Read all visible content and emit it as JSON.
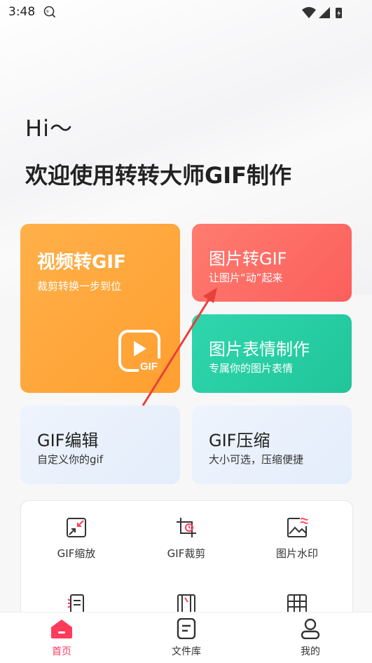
{
  "status_bar": {
    "time": "3:48"
  },
  "header": {
    "greeting": "Hi～",
    "welcome": "欢迎使用转转大师GIF制作"
  },
  "cards": {
    "video_to_gif": {
      "title": "视频转GIF",
      "subtitle": "裁剪转换一步到位",
      "badge": "GIF"
    },
    "image_to_gif": {
      "title": "图片转GIF",
      "subtitle": "让图片“动”起来"
    },
    "emoji_maker": {
      "title": "图片表情制作",
      "subtitle": "专属你的图片表情"
    },
    "gif_edit": {
      "title": "GIF编辑",
      "subtitle": "自定义你的gif"
    },
    "gif_compress": {
      "title": "GIF压缩",
      "subtitle": "大小可选，压缩便捷"
    }
  },
  "tools": [
    {
      "label": "GIF缩放",
      "icon": "resize-icon"
    },
    {
      "label": "GIF裁剪",
      "icon": "crop-icon"
    },
    {
      "label": "图片水印",
      "icon": "watermark-icon"
    }
  ],
  "tabbar": {
    "home": "首页",
    "files": "文件库",
    "mine": "我的"
  },
  "colors": {
    "accent": "#ff3b5c",
    "orange_card": "#ffa43a",
    "red_card": "#fb6a63",
    "green_card": "#27cea4",
    "annotation_arrow": "#e8403a"
  }
}
